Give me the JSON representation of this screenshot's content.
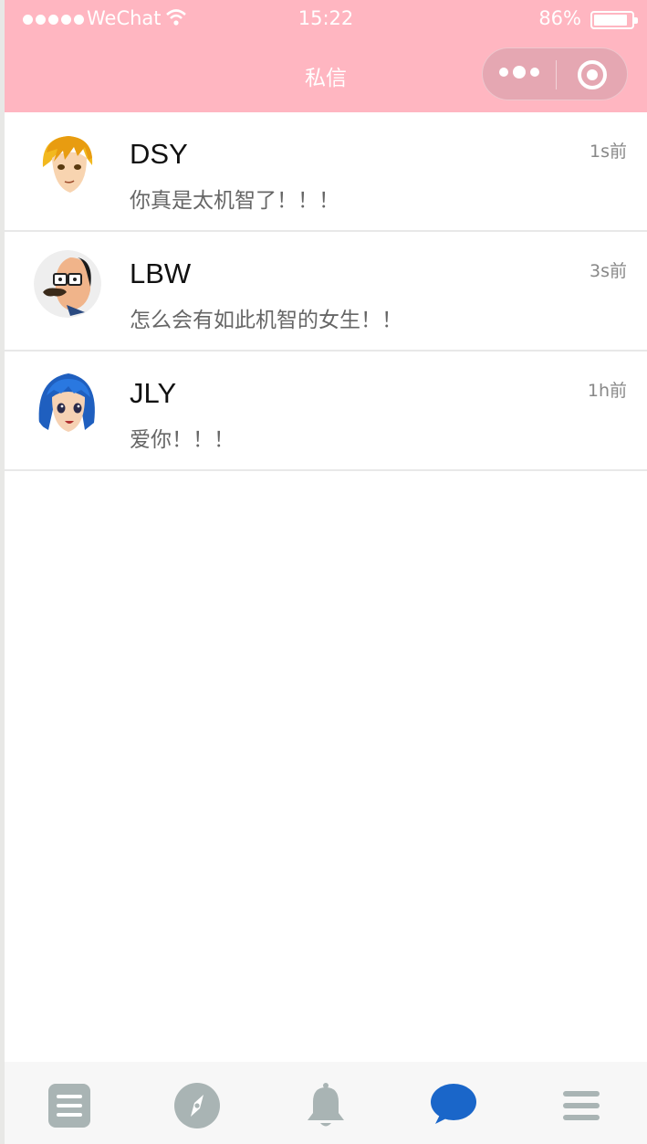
{
  "status_bar": {
    "carrier": "WeChat",
    "time": "15:22",
    "battery": "86%"
  },
  "nav": {
    "title": "私信"
  },
  "messages": [
    {
      "name": "DSY",
      "preview": "你真是太机智了！！！",
      "time": "1s前",
      "avatar": "blonde-girl-avatar"
    },
    {
      "name": "LBW",
      "preview": "怎么会有如此机智的女生！！",
      "time": "3s前",
      "avatar": "mustache-man-avatar"
    },
    {
      "name": "JLY",
      "preview": "爱你！！！",
      "time": "1h前",
      "avatar": "blue-hair-girl-avatar"
    }
  ],
  "tabbar": {
    "items": [
      {
        "icon": "document-icon",
        "active": false
      },
      {
        "icon": "compass-icon",
        "active": false
      },
      {
        "icon": "bell-icon",
        "active": false
      },
      {
        "icon": "chat-bubble-icon",
        "active": true
      },
      {
        "icon": "menu-icon",
        "active": false
      }
    ],
    "inactive_color": "#a9b4b4",
    "active_color": "#1a66c9"
  },
  "colors": {
    "header": "#ffb6c1"
  }
}
